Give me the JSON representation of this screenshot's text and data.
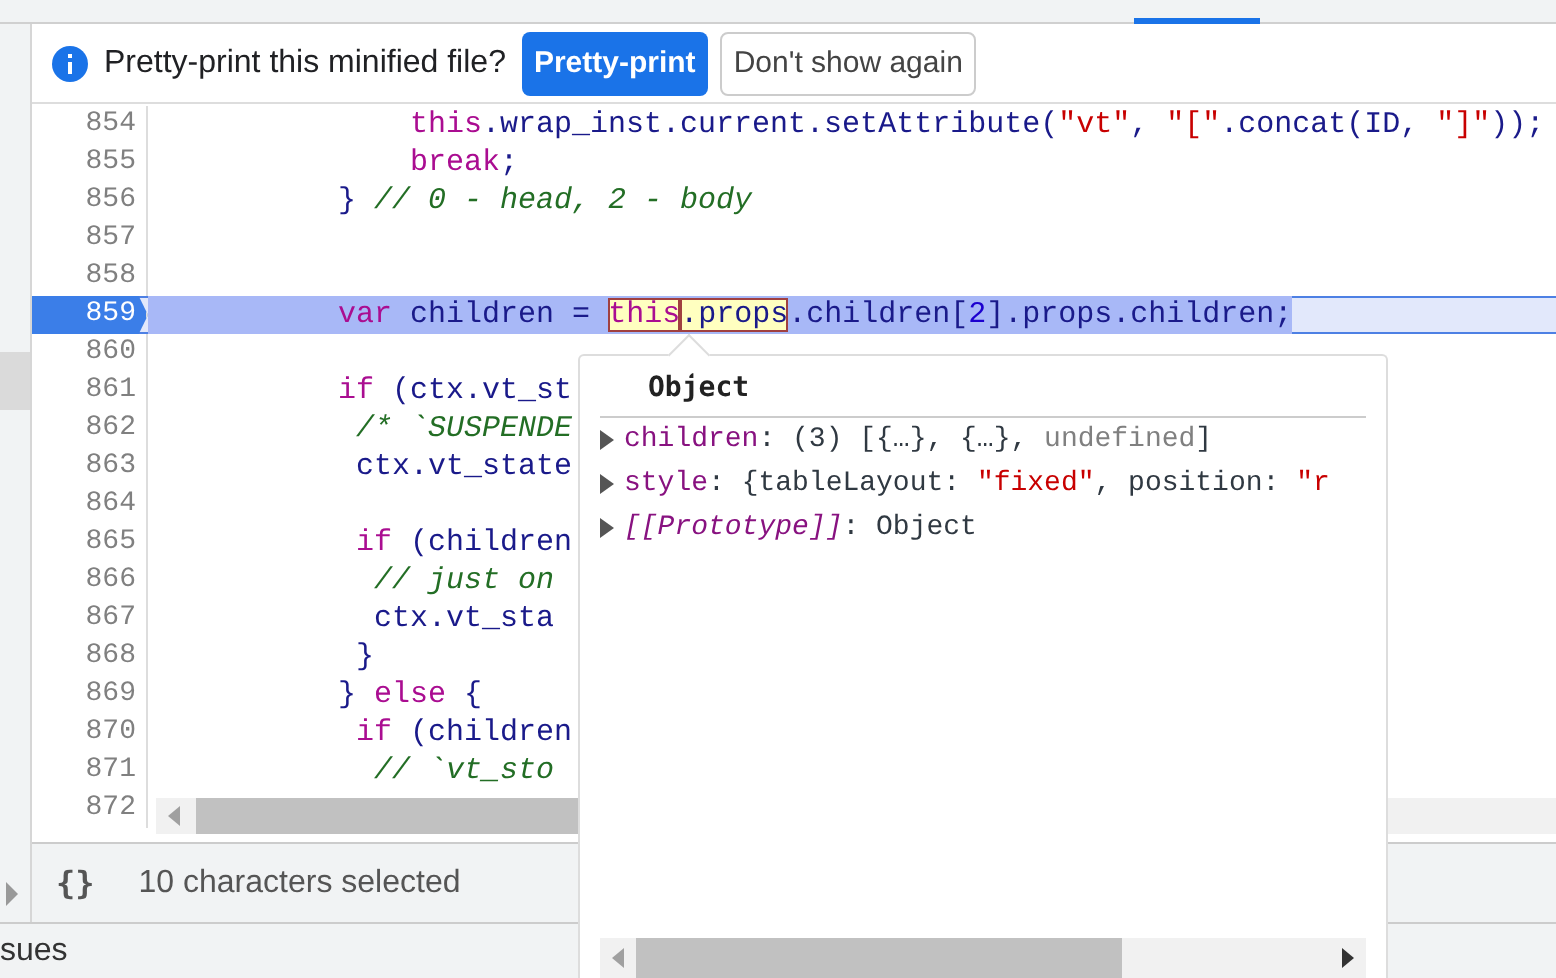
{
  "infobar": {
    "message": "Pretty-print this minified file?",
    "buttons": [
      {
        "label": "Pretty-print",
        "kind": "primary"
      },
      {
        "label": "Don't show again",
        "kind": "secondary"
      }
    ]
  },
  "editor": {
    "lines": [
      {
        "number": "854",
        "current": false,
        "tokens": [
          {
            "kind": "kw",
            "text": "              this"
          },
          {
            "kind": "id",
            "text": ".wrap_inst.current.setAttribute("
          },
          {
            "kind": "str",
            "text": "\"vt\""
          },
          {
            "kind": "id",
            "text": ", "
          },
          {
            "kind": "str",
            "text": "\"[\""
          },
          {
            "kind": "id",
            "text": ".concat(ID, "
          },
          {
            "kind": "str",
            "text": "\"]\""
          },
          {
            "kind": "id",
            "text": "));"
          }
        ]
      },
      {
        "number": "855",
        "current": false,
        "tokens": [
          {
            "kind": "kw",
            "text": "              break"
          },
          {
            "kind": "id",
            "text": ";"
          }
        ]
      },
      {
        "number": "856",
        "current": false,
        "tokens": [
          {
            "kind": "id",
            "text": "          } "
          },
          {
            "kind": "com",
            "text": "// 0 - head, 2 - body"
          }
        ]
      },
      {
        "number": "857",
        "current": false
      },
      {
        "number": "858",
        "current": false
      },
      {
        "number": "859",
        "current": true,
        "tokens": [
          {
            "kind": "kw",
            "text": "          var"
          },
          {
            "kind": "id",
            "text": " children = "
          },
          {
            "kind": "kw",
            "text": "this",
            "highlighted": true
          },
          {
            "kind": "id",
            "text": ".props",
            "highlighted": true
          },
          {
            "kind": "id",
            "text": ".children["
          },
          {
            "kind": "num",
            "text": "2"
          },
          {
            "kind": "id",
            "text": "].props.children;"
          }
        ]
      },
      {
        "number": "860",
        "current": false
      },
      {
        "number": "861",
        "current": false,
        "tokens": [
          {
            "kind": "kw",
            "text": "          if"
          },
          {
            "kind": "id",
            "text": " (ctx.vt_st"
          }
        ]
      },
      {
        "number": "862",
        "current": false,
        "tokens": [
          {
            "kind": "com",
            "text": "           /* `SUSPENDE"
          }
        ]
      },
      {
        "number": "863",
        "current": false,
        "tokens": [
          {
            "kind": "id",
            "text": "           ctx.vt_state"
          }
        ]
      },
      {
        "number": "864",
        "current": false
      },
      {
        "number": "865",
        "current": false,
        "tokens": [
          {
            "kind": "kw",
            "text": "           if"
          },
          {
            "kind": "id",
            "text": " (children"
          }
        ]
      },
      {
        "number": "866",
        "current": false,
        "tokens": [
          {
            "kind": "com",
            "text": "            // just on"
          }
        ]
      },
      {
        "number": "867",
        "current": false,
        "tokens": [
          {
            "kind": "id",
            "text": "            ctx.vt_sta"
          }
        ]
      },
      {
        "number": "868",
        "current": false,
        "tokens": [
          {
            "kind": "id",
            "text": "           }"
          }
        ]
      },
      {
        "number": "869",
        "current": false,
        "tokens": [
          {
            "kind": "id",
            "text": "          } "
          },
          {
            "kind": "kw",
            "text": "else"
          },
          {
            "kind": "id",
            "text": " {"
          }
        ]
      },
      {
        "number": "870",
        "current": false,
        "tokens": [
          {
            "kind": "kw",
            "text": "           if"
          },
          {
            "kind": "id",
            "text": " (children"
          }
        ]
      },
      {
        "number": "871",
        "current": false,
        "tokens": [
          {
            "kind": "com",
            "text": "            // `vt_sto"
          }
        ]
      },
      {
        "number": "872",
        "current": false
      }
    ]
  },
  "popover": {
    "title": "Object",
    "rows": [
      {
        "expanded": false,
        "tokens": [
          {
            "kind": "key",
            "text": "children"
          },
          {
            "kind": "plain",
            "text": ": (3) [{…}, {…}, "
          },
          {
            "kind": "dim",
            "text": "undefined"
          },
          {
            "kind": "plain",
            "text": "]"
          }
        ]
      },
      {
        "expanded": false,
        "tokens": [
          {
            "kind": "key",
            "text": "style"
          },
          {
            "kind": "plain",
            "text": ": {tableLayout: "
          },
          {
            "kind": "str",
            "text": "\"fixed\""
          },
          {
            "kind": "plain",
            "text": ", position: "
          },
          {
            "kind": "str",
            "text": "\"r"
          }
        ]
      },
      {
        "expanded": false,
        "tokens": [
          {
            "kind": "proto",
            "text": "[[Prototype]]"
          },
          {
            "kind": "plain",
            "text": ": Object"
          }
        ]
      }
    ]
  },
  "status_bar": {
    "format_icon": "{}",
    "selection": "10 characters selected"
  },
  "drawer": {
    "tab": "sues"
  }
}
